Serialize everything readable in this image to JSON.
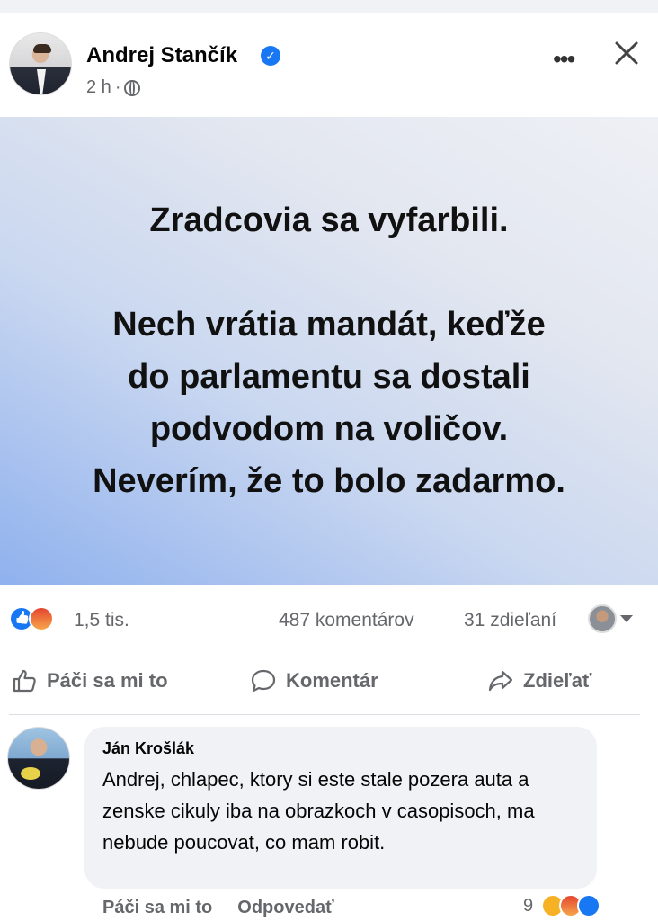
{
  "post": {
    "author": "Andrej Stančík",
    "time": "2 h",
    "separator": "·",
    "image_text": {
      "headline": "Zradcovia sa vyfarbili.",
      "lines": [
        "Nech vrátia mandát, keďže",
        "do parlamentu sa dostali",
        "podvodom na voličov.",
        "Neverím, že to bolo zadarmo."
      ]
    }
  },
  "stats": {
    "reactions": "1,5 tis.",
    "comments": "487 komentárov",
    "shares": "31 zdieľaní"
  },
  "actions": {
    "like": "Páči sa mi to",
    "comment": "Komentár",
    "share": "Zdieľať"
  },
  "comment": {
    "author": "Ján Krošlák",
    "text": "Andrej, chlapec, ktory si este stale pozera auta a zenske cikuly iba na obrazkoch v casopisoch, ma nebude poucovat, co mam robit.",
    "like_label": "Páči sa mi to",
    "reply_label": "Odpovedať",
    "reaction_count": "9"
  },
  "icons": [
    "verified-icon",
    "globe-icon",
    "more-icon",
    "close-icon",
    "like-icon",
    "comment-icon",
    "share-icon"
  ],
  "colors": {
    "accent": "#1877f2",
    "secondary_text": "#65676b",
    "bubble": "#f0f2f5"
  }
}
